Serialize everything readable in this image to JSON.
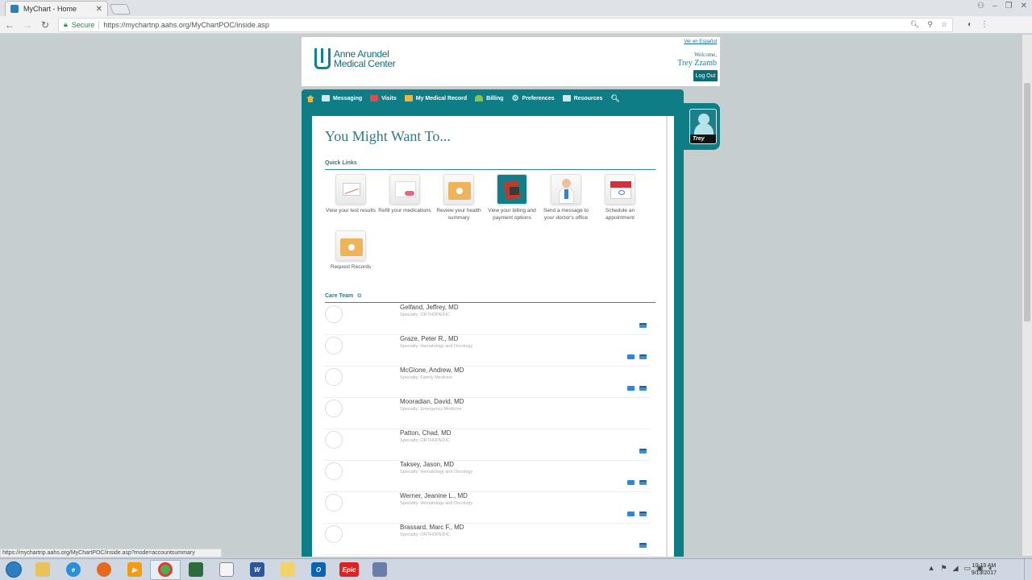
{
  "browser": {
    "tab_title": "MyChart - Home",
    "tab_close": "✕",
    "secure_label": "Secure",
    "url": "https://mychartnp.aahs.org/MyChartPOC/inside.asp",
    "status_url": "https://mychartnp.aahs.org/MyChartPOC/inside.asp?mode=accountsummary"
  },
  "header": {
    "logo_line1": "Anne Arundel",
    "logo_line2": "Medical Center",
    "espanol_link": "Ver en Español",
    "welcome": "Welcome,",
    "username": "Trey Zzamb",
    "logout": "Log Out"
  },
  "nav": {
    "items": [
      {
        "label": "Messaging",
        "icon": "envelope-icon",
        "color": "#cfe6ea"
      },
      {
        "label": "Visits",
        "icon": "calendar-icon",
        "color": "#e24b4b"
      },
      {
        "label": "My Medical Record",
        "icon": "folder-icon",
        "color": "#f0b43c"
      },
      {
        "label": "Billing",
        "icon": "billing-icon",
        "color": "#8bc34a"
      },
      {
        "label": "Preferences",
        "icon": "gear-icon",
        "color": "#cfe6ea"
      },
      {
        "label": "Resources",
        "icon": "book-icon",
        "color": "#cfe6ea"
      }
    ]
  },
  "profile": {
    "name": "Trey"
  },
  "main": {
    "title": "You Might Want To...",
    "quick_links_heading": "Quick Links",
    "quick_links": [
      {
        "label": "View your test results",
        "icon": "test-results-icon"
      },
      {
        "label": "Refill your medications",
        "icon": "medications-icon"
      },
      {
        "label": "Review your health summary",
        "icon": "health-summary-icon"
      },
      {
        "label": "View your billing and payment options",
        "icon": "billing-options-icon"
      },
      {
        "label": "Send a message to your doctor's office",
        "icon": "doctor-message-icon"
      },
      {
        "label": "Schedule an appointment",
        "icon": "schedule-icon"
      },
      {
        "label": "Request Records",
        "icon": "request-records-icon"
      }
    ],
    "care_team_heading": "Care Team",
    "care_team": [
      {
        "name": "Gelfand, Jeffrey, MD",
        "specialty": "Specialty: ORTHOPEDIC",
        "icons": [
          "calendar"
        ]
      },
      {
        "name": "Graze, Peter R., MD",
        "specialty": "Specialty: Hematology and Oncology",
        "icons": [
          "message",
          "calendar"
        ]
      },
      {
        "name": "McGlone, Andrew, MD",
        "specialty": "Specialty: Family Medicine",
        "icons": [
          "message",
          "calendar"
        ]
      },
      {
        "name": "Mooradian, David, MD",
        "specialty": "Specialty: Emergency Medicine",
        "icons": []
      },
      {
        "name": "Patton, Chad, MD",
        "specialty": "Specialty: ORTHOPEDIC",
        "icons": [
          "calendar"
        ]
      },
      {
        "name": "Taksey, Jason, MD",
        "specialty": "Specialty: Hematology and Oncology",
        "icons": [
          "message",
          "calendar"
        ]
      },
      {
        "name": "Werner, Jeanine L., MD",
        "specialty": "Specialty: Hematology and Oncology",
        "icons": [
          "message",
          "calendar"
        ]
      },
      {
        "name": "Brassard, Marc F., MD",
        "specialty": "Specialty: ORTHOPEDIC",
        "icons": [
          "calendar"
        ]
      }
    ]
  },
  "taskbar": {
    "apps": [
      "explorer",
      "internet-explorer",
      "firefox",
      "media-player",
      "chrome",
      "excel-app",
      "notepad",
      "word",
      "folder",
      "outlook",
      "epic",
      "calculator"
    ],
    "epic_label": "Epic",
    "time": "10:19 AM",
    "date": "9/13/2017"
  }
}
